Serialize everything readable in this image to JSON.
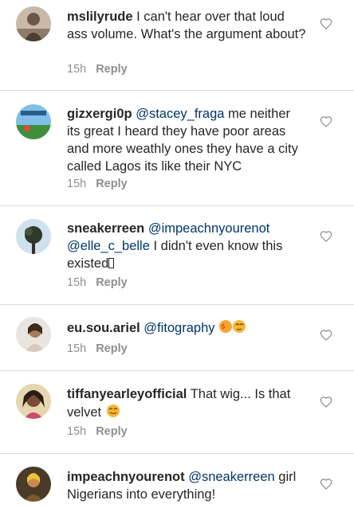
{
  "comments": [
    {
      "username": "mslilyrude",
      "text": "I can't hear over that loud ass volume. What's the argument about?",
      "time": "15h",
      "reply": "Reply"
    },
    {
      "username": "gizxergi0p",
      "mention": "@stacey_fraga",
      "text": "me neither its great I heard they have poor areas and more weathly ones they have a city called Lagos its like their NYC",
      "time": "15h",
      "reply": "Reply"
    },
    {
      "username": "sneakerreen",
      "mention": "@impeachnyourenot",
      "mention2": "@elle_c_belle",
      "text": "I didn't even know this existed",
      "time": "15h",
      "reply": "Reply"
    },
    {
      "username": "eu.sou.ariel",
      "mention": "@fitography",
      "time": "15h",
      "reply": "Reply"
    },
    {
      "username": "tiffanyearleyofficial",
      "text": "That wig... Is that velvet",
      "time": "15h",
      "reply": "Reply"
    },
    {
      "username": "impeachnyourenot",
      "mention": "@sneakerreen",
      "text": "girl Nigerians into everything!"
    }
  ],
  "colors": {
    "text": "#262626",
    "mention": "#003569",
    "meta": "#8e8e8e",
    "divider": "#dbdbdb"
  },
  "icons": {
    "like": "heart-outline-icon"
  }
}
